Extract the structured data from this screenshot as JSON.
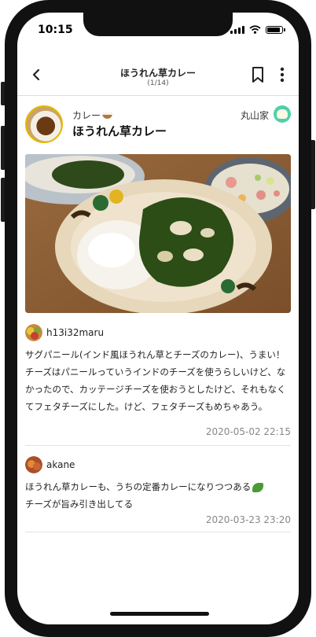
{
  "status_bar": {
    "time": "10:15"
  },
  "navbar": {
    "title": "ほうれん草カレー",
    "subtitle": "(1/14)"
  },
  "recipe": {
    "category": "カレー",
    "title": "ほうれん草カレー",
    "owner": "丸山家"
  },
  "comments": [
    {
      "user": "h13i32maru",
      "text": "サグパニール(インド風ほうれん草とチーズのカレー)、うまい！チーズはパニールっていうインドのチーズを使うらしいけど、なかったので、カッテージチーズを使おうとしたけど、それもなくてフェタチーズにした。けど、フェタチーズもめちゃあう。",
      "timestamp": "2020-05-02 22:15"
    },
    {
      "user": "akane",
      "text": "ほうれん草カレーも、うちの定番カレーになりつつある",
      "text2": "チーズが旨み引き出してる",
      "timestamp": "2020-03-23 23:20"
    }
  ]
}
